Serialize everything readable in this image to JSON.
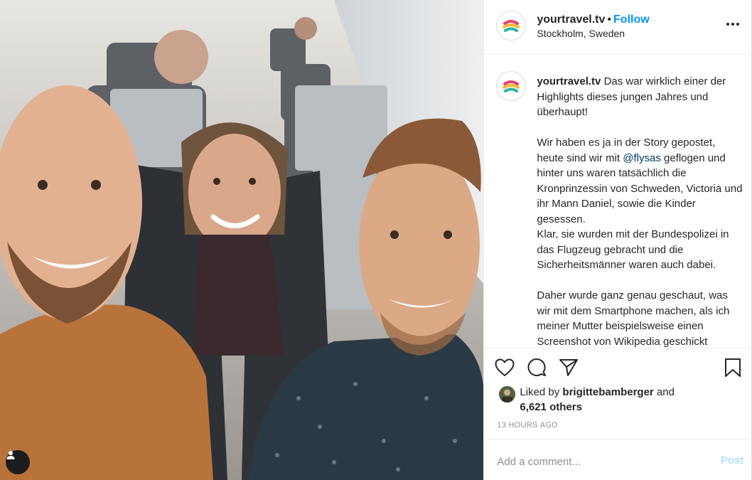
{
  "colors": {
    "accent": "#0095f6",
    "mention": "#00376b",
    "muted": "#8e8e8e",
    "post_disabled": "#b2dffc"
  },
  "photo": {
    "alt_icon": "user-tag-icon"
  },
  "header": {
    "username": "yourtravel.tv",
    "separator": "•",
    "follow_label": "Follow",
    "location": "Stockholm, Sweden",
    "more_icon": "more-options-icon"
  },
  "caption": {
    "username": "yourtravel.tv",
    "p1": "Das war wirklich einer der Highlights dieses jungen Jahres und überhaupt!",
    "p2_before": "Wir haben es ja in der Story gepostet, heute sind wir mit ",
    "p2_mention": "@flysas",
    "p2_after": " geflogen und hinter uns waren tatsächlich die Kronprinzessin von Schweden, Victoria und ihr Mann Daniel, sowie die Kinder gesessen.",
    "p3": "Klar, sie wurden mit der Bundespolizei in das Flugzeug gebracht und die Sicherheitsmänner waren auch dabei.",
    "p4": "Daher wurde ganz genau geschaut, was wir mit dem Smartphone machen, als ich meiner Mutter beispielsweise einen Screenshot von Wikipedia geschickt habe..."
  },
  "actions": {
    "like_icon": "heart-icon",
    "comment_icon": "comment-icon",
    "share_icon": "share-icon",
    "save_icon": "bookmark-icon"
  },
  "likes": {
    "prefix": "Liked by ",
    "user": "brigittebamberger",
    "conjunction": " and",
    "others": "6,621 others"
  },
  "timestamp": "13 HOURS AGO",
  "comment": {
    "placeholder": "Add a comment...",
    "post_label": "Post"
  }
}
